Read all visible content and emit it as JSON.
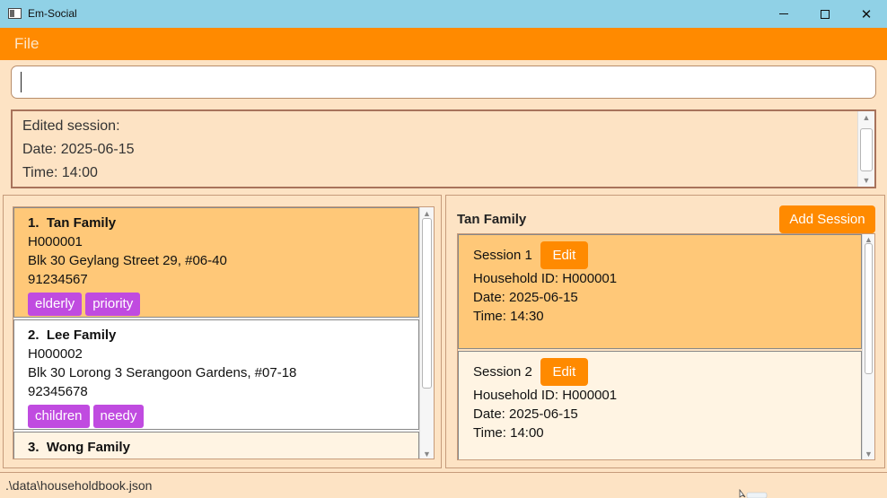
{
  "window": {
    "title": "Em-Social",
    "minimize": "—",
    "close": "✕"
  },
  "menu": {
    "file": "File"
  },
  "command": {
    "value": "",
    "placeholder": ""
  },
  "result": {
    "lines": [
      "Edited session:",
      "Date: 2025-06-15",
      "Time: 14:00"
    ]
  },
  "households": [
    {
      "index": "1.",
      "name": "Tan Family",
      "id": "H000001",
      "address": "Blk 30 Geylang Street 29, #06-40",
      "phone": "91234567",
      "tags": [
        "elderly",
        "priority"
      ],
      "selected": true
    },
    {
      "index": "2.",
      "name": "Lee Family",
      "id": "H000002",
      "address": "Blk 30 Lorong 3 Serangoon Gardens, #07-18",
      "phone": "92345678",
      "tags": [
        "children",
        "needy"
      ],
      "selected": false
    },
    {
      "index": "3.",
      "name": "Wong Family",
      "id": "",
      "address": "",
      "phone": "",
      "tags": [],
      "selected": false
    }
  ],
  "detail": {
    "title": "Tan Family",
    "add_session_label": "Add Session",
    "sessions": [
      {
        "label": "Session 1",
        "edit_label": "Edit",
        "household_id": "Household ID: H000001",
        "date": "Date: 2025-06-15",
        "time": "Time: 14:30"
      },
      {
        "label": "Session 2",
        "edit_label": "Edit",
        "household_id": "Household ID: H000001",
        "date": "Date: 2025-06-15",
        "time": "Time: 14:00"
      }
    ]
  },
  "status": {
    "path": ".\\data\\householdbook.json"
  },
  "colors": {
    "titlebar": "#90d1e6",
    "accent": "#ff8a00",
    "background": "#fde3c4",
    "selected_card": "#ffc878",
    "tag": "#c04be0"
  }
}
